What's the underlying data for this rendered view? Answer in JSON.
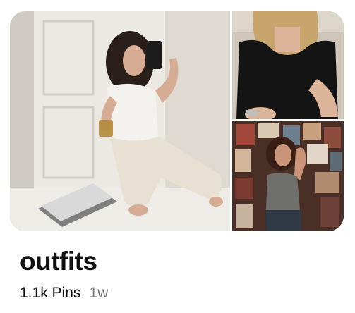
{
  "board": {
    "title": "outfits",
    "pin_count": "1.1k Pins",
    "updated": "1w"
  },
  "images": [
    {
      "name": "cover-image",
      "icon": "photo-woman-white-outfit-mirror-selfie"
    },
    {
      "name": "secondary-image-top",
      "icon": "photo-woman-black-top"
    },
    {
      "name": "secondary-image-bottom",
      "icon": "photo-woman-poster-wall"
    }
  ],
  "colors": {
    "title": "#111111",
    "meta_secondary": "#767676",
    "background": "#ffffff"
  }
}
